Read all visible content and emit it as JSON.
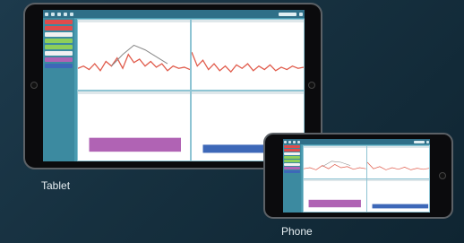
{
  "labels": {
    "tablet": "Tablet",
    "phone": "Phone"
  },
  "colors": {
    "background": "#16303f",
    "app_chrome": "#4a9bb0",
    "waveform": "#e05a4a",
    "overlay": "#888888",
    "bar_purple": "#b063b4",
    "bar_blue": "#3d68b8"
  },
  "toolbar_icons": [
    "menu-icon",
    "save-icon",
    "print-icon",
    "close-icon",
    "settings-icon",
    "search-icon"
  ],
  "sidebar_items": [
    "marker-red",
    "marker-red",
    "marker-white",
    "marker-green",
    "marker-green",
    "marker-white",
    "marker-purple",
    "marker-blue"
  ]
}
